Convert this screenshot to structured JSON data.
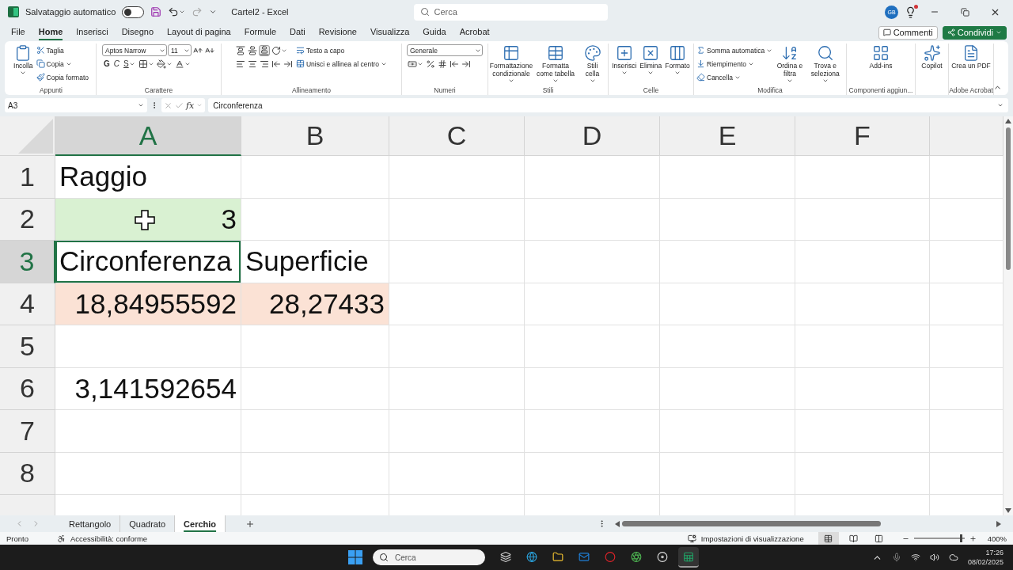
{
  "title_bar": {
    "autosave_label": "Salvataggio automatico",
    "autosave_on": false,
    "document_title": "Cartel2 - Excel",
    "search_placeholder": "Cerca",
    "avatar": "GB"
  },
  "menu_tabs": [
    {
      "label": "File",
      "selected": false
    },
    {
      "label": "Home",
      "selected": true
    },
    {
      "label": "Inserisci",
      "selected": false
    },
    {
      "label": "Disegno",
      "selected": false
    },
    {
      "label": "Layout di pagina",
      "selected": false
    },
    {
      "label": "Formule",
      "selected": false
    },
    {
      "label": "Dati",
      "selected": false
    },
    {
      "label": "Revisione",
      "selected": false
    },
    {
      "label": "Visualizza",
      "selected": false
    },
    {
      "label": "Guida",
      "selected": false
    },
    {
      "label": "Acrobat",
      "selected": false
    }
  ],
  "header_buttons": {
    "comments": "Commenti",
    "share": "Condividi"
  },
  "ribbon": [
    {
      "label": "Appunti",
      "columns": [
        {
          "kind": "large",
          "label": "Incolla",
          "menu": true
        },
        {
          "kind": "stack",
          "lines": [
            [
              {
                "kind": "small",
                "label": "Taglia",
                "menu": false
              }
            ],
            [
              {
                "kind": "small",
                "label": "Copia",
                "menu": true
              }
            ],
            [
              {
                "kind": "small",
                "label": "Copia formato",
                "menu": false
              }
            ]
          ]
        }
      ]
    },
    {
      "label": "Carattere",
      "columns": [
        {
          "kind": "stack",
          "lines": [
            [
              {
                "kind": "field",
                "label": "Aptos Narrow"
              },
              {
                "kind": "field",
                "label": "11"
              },
              {
                "kind": "icon",
                "menu": false
              },
              {
                "kind": "icon",
                "menu": false
              }
            ],
            [
              {
                "kind": "text",
                "label": "G",
                "menu": false
              },
              {
                "kind": "text",
                "label": "C",
                "menu": false
              },
              {
                "kind": "text",
                "label": "S",
                "menu": true
              },
              {
                "kind": "icon",
                "menu": true
              },
              {
                "kind": "icon",
                "menu": true
              },
              {
                "kind": "icon",
                "menu": true
              }
            ]
          ]
        }
      ]
    },
    {
      "label": "Allineamento",
      "columns": [
        {
          "kind": "stack",
          "lines": [
            [
              {
                "kind": "icon",
                "menu": false,
                "selected": false
              },
              {
                "kind": "icon",
                "menu": false,
                "selected": false
              },
              {
                "kind": "icon",
                "menu": false,
                "selected": true
              },
              {
                "kind": "icon",
                "menu": true
              }
            ],
            [
              {
                "kind": "icon",
                "menu": false,
                "selected": false
              },
              {
                "kind": "icon",
                "menu": false,
                "selected": false
              },
              {
                "kind": "icon",
                "menu": false,
                "selected": false
              },
              {
                "kind": "icon",
                "menu": false
              },
              {
                "kind": "icon",
                "menu": false
              }
            ]
          ]
        },
        {
          "kind": "stack",
          "lines": [
            [
              {
                "kind": "small",
                "label": "Testo a capo",
                "menu": false
              }
            ],
            [
              {
                "kind": "small",
                "label": "Unisci e allinea al centro",
                "menu": true
              }
            ]
          ]
        }
      ]
    },
    {
      "label": "Numeri",
      "columns": [
        {
          "kind": "stack",
          "lines": [
            [
              {
                "kind": "field",
                "label": "Generale"
              }
            ],
            [
              {
                "kind": "icon",
                "menu": true
              },
              {
                "kind": "icon",
                "menu": false
              },
              {
                "kind": "icon",
                "menu": false
              },
              {
                "kind": "icon",
                "menu": false
              },
              {
                "kind": "icon",
                "menu": false
              }
            ]
          ]
        }
      ]
    },
    {
      "label": "Stili",
      "columns": [
        {
          "kind": "large",
          "label": "Formattazione condizionale",
          "menu": true
        },
        {
          "kind": "large",
          "label": "Formatta come tabella",
          "menu": true
        },
        {
          "kind": "large",
          "label": "Stili cella",
          "menu": true
        }
      ]
    },
    {
      "label": "Celle",
      "columns": [
        {
          "kind": "large",
          "label": "Inserisci",
          "menu": true
        },
        {
          "kind": "large",
          "label": "Elimina",
          "menu": true
        },
        {
          "kind": "large",
          "label": "Formato",
          "menu": true
        }
      ]
    },
    {
      "label": "Modifica",
      "columns": [
        {
          "kind": "stack",
          "lines": [
            [
              {
                "kind": "small",
                "label": "Somma automatica",
                "menu": true
              }
            ],
            [
              {
                "kind": "small",
                "label": "Riempimento",
                "menu": true
              }
            ],
            [
              {
                "kind": "small",
                "label": "Cancella",
                "menu": true
              }
            ]
          ]
        },
        {
          "kind": "large",
          "label": "Ordina e filtra",
          "menu": true
        },
        {
          "kind": "large",
          "label": "Trova e seleziona",
          "menu": true
        }
      ]
    },
    {
      "label": "Componenti aggiun...",
      "columns": [
        {
          "kind": "large",
          "label": "Add-ins",
          "menu": false
        }
      ]
    },
    {
      "columns": [
        {
          "kind": "large",
          "label": "Copilot",
          "menu": false
        }
      ]
    },
    {
      "label": "Adobe Acrobat",
      "columns": [
        {
          "kind": "large",
          "label": "Crea un PDF",
          "menu": false
        }
      ]
    }
  ],
  "formula_bar": {
    "name_box": "A3",
    "fx": "fx",
    "formula": "Circonferenza"
  },
  "sheet": {
    "columns": [
      {
        "label": "A",
        "selected": true
      },
      {
        "label": "B",
        "selected": false
      },
      {
        "label": "C",
        "selected": false
      },
      {
        "label": "D",
        "selected": false
      },
      {
        "label": "E",
        "selected": false
      },
      {
        "label": "F",
        "selected": false
      },
      {
        "selected": false
      }
    ],
    "rows": [
      {
        "label": "1",
        "selected": false,
        "cells": [
          {
            "text": "Raggio",
            "kind": "text",
            "selected": false
          },
          {
            "selected": false
          },
          {
            "selected": false
          },
          {
            "selected": false
          },
          {
            "selected": false
          },
          {
            "selected": false
          },
          {
            "selected": false
          }
        ]
      },
      {
        "label": "2",
        "selected": false,
        "cells": [
          {
            "text": "3",
            "kind": "number",
            "color": "#d9f1d2",
            "selected": false
          },
          {
            "selected": false
          },
          {
            "selected": false
          },
          {
            "selected": false
          },
          {
            "selected": false
          },
          {
            "selected": false
          },
          {
            "selected": false
          }
        ]
      },
      {
        "label": "3",
        "selected": true,
        "cells": [
          {
            "text": "Circonferenza",
            "kind": "text",
            "selected": true
          },
          {
            "text": "Superficie",
            "kind": "text",
            "selected": false
          },
          {
            "selected": false
          },
          {
            "selected": false
          },
          {
            "selected": false
          },
          {
            "selected": false
          },
          {
            "selected": false
          }
        ]
      },
      {
        "label": "4",
        "selected": false,
        "cells": [
          {
            "text": "18,84955592",
            "kind": "number",
            "color": "#fbe2d5",
            "selected": false
          },
          {
            "text": "28,27433",
            "kind": "number",
            "color": "#fbe2d5",
            "selected": false
          },
          {
            "selected": false
          },
          {
            "selected": false
          },
          {
            "selected": false
          },
          {
            "selected": false
          },
          {
            "selected": false
          }
        ]
      },
      {
        "label": "5",
        "selected": false,
        "cells": [
          {
            "selected": false
          },
          {
            "selected": false
          },
          {
            "selected": false
          },
          {
            "selected": false
          },
          {
            "selected": false
          },
          {
            "selected": false
          },
          {
            "selected": false
          }
        ]
      },
      {
        "label": "6",
        "selected": false,
        "cells": [
          {
            "text": "3,141592654",
            "kind": "number",
            "selected": false
          },
          {
            "selected": false
          },
          {
            "selected": false
          },
          {
            "selected": false
          },
          {
            "selected": false
          },
          {
            "selected": false
          },
          {
            "selected": false
          }
        ]
      },
      {
        "label": "7",
        "selected": false,
        "cells": [
          {
            "selected": false
          },
          {
            "selected": false
          },
          {
            "selected": false
          },
          {
            "selected": false
          },
          {
            "selected": false
          },
          {
            "selected": false
          },
          {
            "selected": false
          }
        ]
      },
      {
        "label": "8",
        "selected": false,
        "cells": [
          {
            "selected": false
          },
          {
            "selected": false
          },
          {
            "selected": false
          },
          {
            "selected": false
          },
          {
            "selected": false
          },
          {
            "selected": false
          },
          {
            "selected": false
          }
        ]
      },
      {
        "selected": false,
        "cells": [
          {
            "selected": false
          },
          {
            "selected": false
          },
          {
            "selected": false
          },
          {
            "selected": false
          },
          {
            "selected": false
          },
          {
            "selected": false
          },
          {
            "selected": false
          }
        ]
      }
    ]
  },
  "sheet_tabs": [
    {
      "label": "Rettangolo",
      "selected": false
    },
    {
      "label": "Quadrato",
      "selected": false
    },
    {
      "label": "Cerchio",
      "selected": true
    }
  ],
  "status_bar": {
    "status": "Pronto",
    "accessibility": "Accessibilità: conforme",
    "view_settings": "Impostazioni di visualizzazione",
    "views": [
      {
        "selected": true
      },
      {
        "selected": false
      },
      {
        "selected": false
      }
    ],
    "zoom_slider": {
      "level": 0.93
    },
    "zoom": "400%"
  },
  "taskbar": {
    "search_placeholder": "Cerca",
    "apps": [
      {
        "selected": false
      },
      {
        "selected": false
      },
      {
        "selected": false
      },
      {
        "selected": false
      },
      {
        "selected": false
      },
      {
        "selected": false
      },
      {
        "selected": false
      },
      {
        "selected": true
      }
    ],
    "time": "17:26",
    "date": "08/02/2025"
  }
}
